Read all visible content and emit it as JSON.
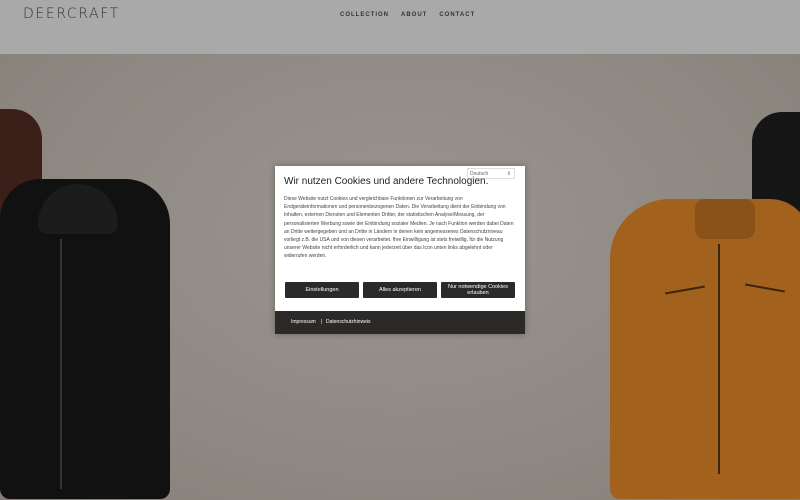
{
  "brand": "DEERCRAFT",
  "nav": [
    "COLLECTION",
    "ABOUT",
    "CONTACT"
  ],
  "cookie": {
    "language": "Deutsch",
    "title": "Wir nutzen Cookies und andere Technologien.",
    "body": "Diese Website nutzt Cookies und vergleichbare Funktionen zur Verarbeitung von Endgeräteinformationen und personenbezogenen Daten. Die Verarbeitung dient der Einbindung von Inhalten, externen Diensten und Elementen Dritter, der statistischen Analyse/Messung, der personalisierten Werbung sowie der Einbindung sozialer Medien. Je nach Funktion werden dabei Daten an Dritte weitergegeben und an Dritte in Ländern in denen kein angemessenes Datenschutzniveau vorliegt z.B. die USA und von diesen verarbeitet. Ihre Einwilligung ist stets freiwillig, für die Nutzung unserer Website nicht erforderlich und kann jederzeit über das Icon unten links abgelehnt oder widerrufen werden.",
    "buttons": [
      "Einstellungen",
      "Alles akzeptieren",
      "Nur notwendige Cookies erlauben"
    ],
    "footer_links": [
      "Impressum",
      "|",
      "Datenschutzhinweis"
    ]
  }
}
